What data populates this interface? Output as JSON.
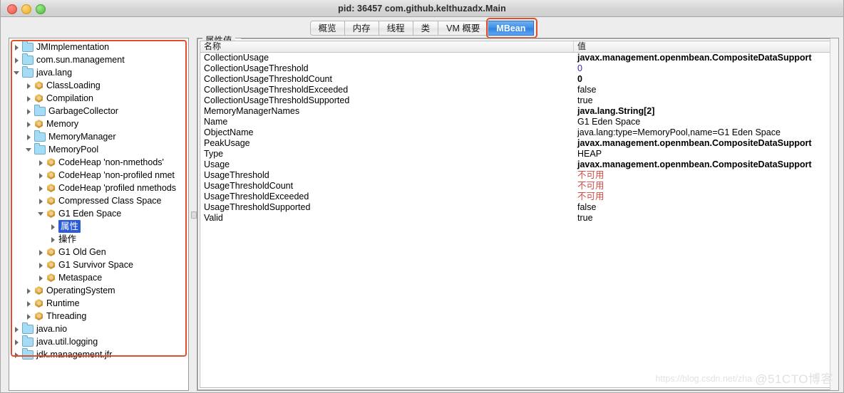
{
  "window": {
    "title": "pid: 36457 com.github.kelthuzadx.Main",
    "traffic_lights": [
      "close-button",
      "minimize-button",
      "zoom-button"
    ]
  },
  "tabs": {
    "items": [
      {
        "label": "概览",
        "selected": false
      },
      {
        "label": "内存",
        "selected": false
      },
      {
        "label": "线程",
        "selected": false
      },
      {
        "label": "类",
        "selected": false
      },
      {
        "label": "VM 概要",
        "selected": false
      },
      {
        "label": "MBean",
        "selected": true
      }
    ],
    "highlight_color": "#e04f2a",
    "selected_color": "#2f80e0"
  },
  "tree": {
    "nodes": [
      {
        "label": "JMImplementation",
        "icon": "folder-icon",
        "indent": 0,
        "state": "closed",
        "selected": false
      },
      {
        "label": "com.sun.management",
        "icon": "folder-icon",
        "indent": 0,
        "state": "closed",
        "selected": false
      },
      {
        "label": "java.lang",
        "icon": "folder-icon",
        "indent": 0,
        "state": "open",
        "selected": false
      },
      {
        "label": "ClassLoading",
        "icon": "bean-icon",
        "indent": 1,
        "state": "closed",
        "selected": false
      },
      {
        "label": "Compilation",
        "icon": "bean-icon",
        "indent": 1,
        "state": "closed",
        "selected": false
      },
      {
        "label": "GarbageCollector",
        "icon": "folder-icon",
        "indent": 1,
        "state": "closed",
        "selected": false
      },
      {
        "label": "Memory",
        "icon": "bean-icon",
        "indent": 1,
        "state": "closed",
        "selected": false
      },
      {
        "label": "MemoryManager",
        "icon": "folder-icon",
        "indent": 1,
        "state": "closed",
        "selected": false
      },
      {
        "label": "MemoryPool",
        "icon": "folder-icon",
        "indent": 1,
        "state": "open",
        "selected": false
      },
      {
        "label": "CodeHeap 'non-nmethods'",
        "icon": "bean-icon",
        "indent": 2,
        "state": "closed",
        "selected": false
      },
      {
        "label": "CodeHeap 'non-profiled nmet",
        "icon": "bean-icon",
        "indent": 2,
        "state": "closed",
        "selected": false
      },
      {
        "label": "CodeHeap 'profiled nmethods",
        "icon": "bean-icon",
        "indent": 2,
        "state": "closed",
        "selected": false
      },
      {
        "label": "Compressed Class Space",
        "icon": "bean-icon",
        "indent": 2,
        "state": "closed",
        "selected": false
      },
      {
        "label": "G1 Eden Space",
        "icon": "bean-icon",
        "indent": 2,
        "state": "open",
        "selected": false
      },
      {
        "label": "属性",
        "icon": "none",
        "indent": 3,
        "state": "closed",
        "selected": true
      },
      {
        "label": "操作",
        "icon": "none",
        "indent": 3,
        "state": "closed",
        "selected": false
      },
      {
        "label": "G1 Old Gen",
        "icon": "bean-icon",
        "indent": 2,
        "state": "closed",
        "selected": false
      },
      {
        "label": "G1 Survivor Space",
        "icon": "bean-icon",
        "indent": 2,
        "state": "closed",
        "selected": false
      },
      {
        "label": "Metaspace",
        "icon": "bean-icon",
        "indent": 2,
        "state": "closed",
        "selected": false
      },
      {
        "label": "OperatingSystem",
        "icon": "bean-icon",
        "indent": 1,
        "state": "closed",
        "selected": false
      },
      {
        "label": "Runtime",
        "icon": "bean-icon",
        "indent": 1,
        "state": "closed",
        "selected": false
      },
      {
        "label": "Threading",
        "icon": "bean-icon",
        "indent": 1,
        "state": "closed",
        "selected": false
      },
      {
        "label": "java.nio",
        "icon": "folder-icon",
        "indent": 0,
        "state": "closed",
        "selected": false
      },
      {
        "label": "java.util.logging",
        "icon": "folder-icon",
        "indent": 0,
        "state": "closed",
        "selected": false
      },
      {
        "label": "jdk.management.jfr",
        "icon": "folder-icon",
        "indent": 0,
        "state": "closed",
        "selected": false
      }
    ]
  },
  "attributes_panel": {
    "group_title": "属性值",
    "columns": [
      "名称",
      "值"
    ],
    "rows": [
      {
        "name": "CollectionUsage",
        "value": "javax.management.openmbean.CompositeDataSupport",
        "style": "bold"
      },
      {
        "name": "CollectionUsageThreshold",
        "value": "0",
        "style": "link"
      },
      {
        "name": "CollectionUsageThresholdCount",
        "value": "0",
        "style": "bold"
      },
      {
        "name": "CollectionUsageThresholdExceeded",
        "value": "false",
        "style": "plain"
      },
      {
        "name": "CollectionUsageThresholdSupported",
        "value": "true",
        "style": "plain"
      },
      {
        "name": "MemoryManagerNames",
        "value": "java.lang.String[2]",
        "style": "bold"
      },
      {
        "name": "Name",
        "value": "G1 Eden Space",
        "style": "plain"
      },
      {
        "name": "ObjectName",
        "value": "java.lang:type=MemoryPool,name=G1 Eden Space",
        "style": "plain"
      },
      {
        "name": "PeakUsage",
        "value": "javax.management.openmbean.CompositeDataSupport",
        "style": "bold"
      },
      {
        "name": "Type",
        "value": "HEAP",
        "style": "plain"
      },
      {
        "name": "Usage",
        "value": "javax.management.openmbean.CompositeDataSupport",
        "style": "bold"
      },
      {
        "name": "UsageThreshold",
        "value": "不可用",
        "style": "na"
      },
      {
        "name": "UsageThresholdCount",
        "value": "不可用",
        "style": "na"
      },
      {
        "name": "UsageThresholdExceeded",
        "value": "不可用",
        "style": "na"
      },
      {
        "name": "UsageThresholdSupported",
        "value": "false",
        "style": "plain"
      },
      {
        "name": "Valid",
        "value": "true",
        "style": "plain"
      }
    ]
  },
  "watermarks": {
    "csdn": "https://blog.csdn.net/zha",
    "cto": "@51CTO博客"
  }
}
